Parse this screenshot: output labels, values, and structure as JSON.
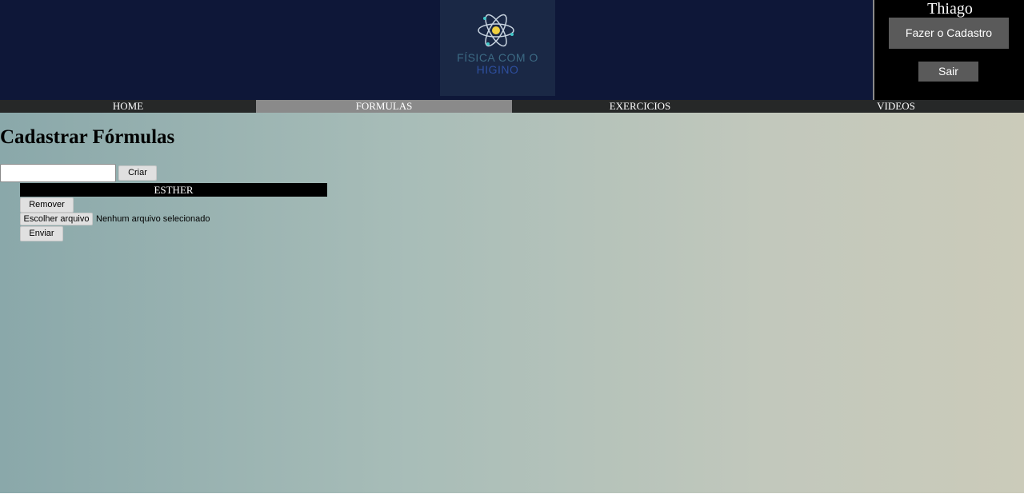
{
  "header": {
    "logo": {
      "line1": "FÍSICA COM O",
      "line2": "HIGINO",
      "icon": "atom-icon"
    },
    "user": {
      "name": "Thiago",
      "register_label": "Fazer o Cadastro",
      "logout_label": "Sair"
    }
  },
  "nav": {
    "items": [
      {
        "label": "HOME"
      },
      {
        "label": "FORMULAS"
      },
      {
        "label": "EXERCICIOS"
      },
      {
        "label": "VIDEOS"
      }
    ],
    "active": "FORMULAS"
  },
  "main": {
    "title": "Cadastrar Fórmulas",
    "name_input": {
      "value": "",
      "placeholder": ""
    },
    "create_label": "Criar",
    "items": [
      {
        "name": "ESTHER",
        "remove_label": "Remover",
        "file_button_label": "Escolher arquivo",
        "file_status": "Nenhum arquivo selecionado",
        "submit_label": "Enviar"
      }
    ]
  },
  "colors": {
    "header_bg": "#0e1738",
    "user_panel_bg": "#000000",
    "nav_bg": "#262828",
    "nav_active_bg": "#8a8a8a",
    "button_dark": "#5a5a5a"
  }
}
